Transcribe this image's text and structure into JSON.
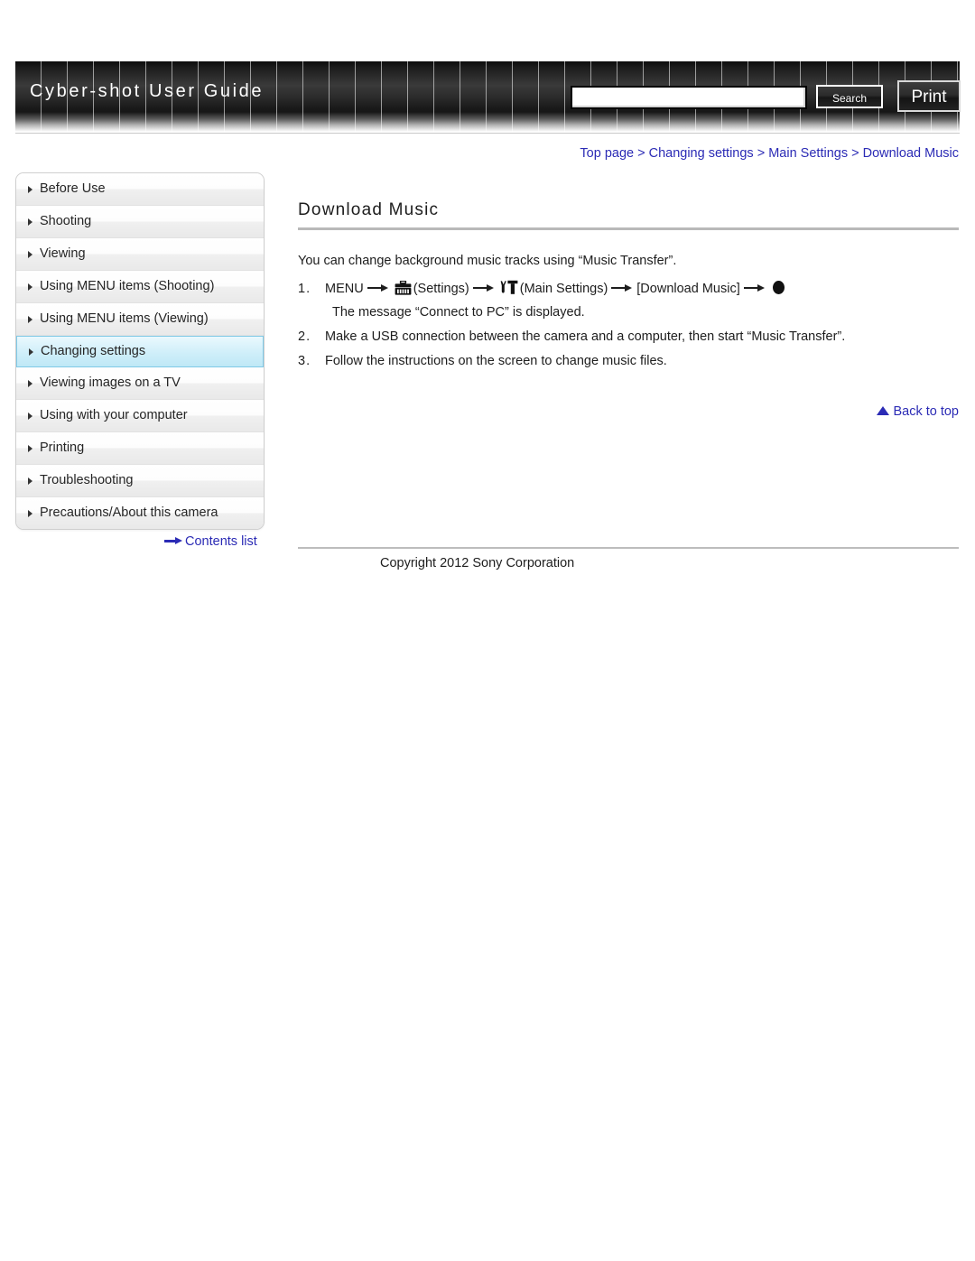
{
  "header": {
    "title": "Cyber-shot User Guide",
    "search": {
      "value": "",
      "placeholder": "",
      "button_label": "Search"
    },
    "print_label": "Print"
  },
  "breadcrumb": {
    "items": [
      {
        "label": "Top page"
      },
      {
        "label": "Changing settings"
      },
      {
        "label": "Main Settings"
      },
      {
        "label": "Download Music"
      }
    ],
    "separator": ">",
    "color": "#2b2bb5"
  },
  "sidebar": {
    "items": [
      {
        "label": "Before Use",
        "active": false
      },
      {
        "label": "Shooting",
        "active": false
      },
      {
        "label": "Viewing",
        "active": false
      },
      {
        "label": "Using MENU items (Shooting)",
        "active": false
      },
      {
        "label": "Using MENU items (Viewing)",
        "active": false
      },
      {
        "label": "Changing settings",
        "active": true
      },
      {
        "label": "Viewing images on a TV",
        "active": false
      },
      {
        "label": "Using with your computer",
        "active": false
      },
      {
        "label": "Printing",
        "active": false
      },
      {
        "label": "Troubleshooting",
        "active": false
      },
      {
        "label": "Precautions/About this camera",
        "active": false
      }
    ],
    "contents_link": "Contents list",
    "active_color": "#bfe8f6"
  },
  "main": {
    "title": "Download Music",
    "lead": "You can change background music tracks using “Music Transfer”.",
    "steps": [
      {
        "num": "1.",
        "segments": [
          {
            "type": "text",
            "value": "MENU"
          },
          {
            "type": "arrow"
          },
          {
            "type": "icon",
            "value": "toolbox-settings-icon"
          },
          {
            "type": "text",
            "value": "(Settings)"
          },
          {
            "type": "arrow"
          },
          {
            "type": "icon",
            "value": "wrench-toolbox-main-settings-icon"
          },
          {
            "type": "text",
            "value": "(Main Settings)"
          },
          {
            "type": "arrow"
          },
          {
            "type": "text",
            "value": "[Download Music]"
          },
          {
            "type": "arrow"
          },
          {
            "type": "icon",
            "value": "center-button-dot-icon"
          }
        ],
        "sub": "The message “Connect to PC” is displayed."
      },
      {
        "num": "2.",
        "text": "Make a USB connection between the camera and a computer, then start “Music Transfer”.",
        "sub": ""
      },
      {
        "num": "3.",
        "text": "Follow the instructions on the screen to change music files.",
        "sub": ""
      }
    ],
    "step1_parts": {
      "menu": "MENU",
      "settings": "(Settings)",
      "main_settings": "(Main Settings)",
      "download_music": "[Download Music]"
    },
    "back_to_top": "Back to top"
  },
  "footer": {
    "copyright": "Copyright 2012 Sony Corporation"
  }
}
